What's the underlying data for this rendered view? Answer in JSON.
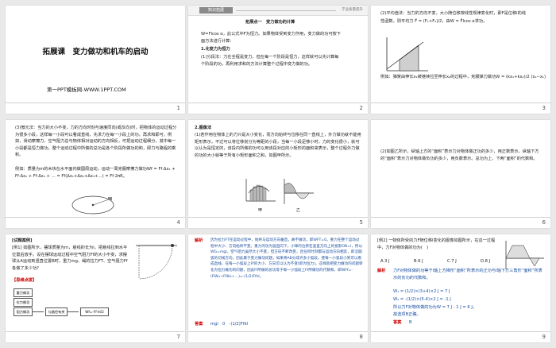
{
  "slide1": {
    "title": "拓展课　变力做功和机车的启动",
    "subtitle": "第一PPT模板网-WWW.1PPT.COM",
    "number": "1"
  },
  "slide2": {
    "tag": "知识拓展",
    "header_right": "学业质量提升",
    "heading": "拓展点一　变力做功的计算",
    "intro": "W=Flcos α，此公式中F为恒力。如果物体受到变力作用，变力做的功可按下",
    "intro2": "面方法进行计算：",
    "item1": "1.化变力为恒力",
    "item1_text": "(1)分段法：力在全程是变力，但在每一个阶段是恒力，这样就可以先计算每",
    "item1_text2": "个阶段的功，再利用求和的方法计算整个过程中变力做的功。",
    "number": "2"
  },
  "slide3": {
    "line1": "(2)平均值法：当力的方向不变，大小随位移按线性规律变化时，即F是位移l的线",
    "line2": "性函数，则平均力 F̄ = (F₁+F₂)/2，由W = F̄lcos α求功。",
    "line3": "例如：弹簧由伸长x₁被继续拉至伸长x₂的过程中，克服弹力做功W = (kx₁+kx₂)/2 (x₂−x₁)",
    "number": "3"
  },
  "slide4": {
    "para": "(3)微元法：当力的大小不变，力的方向时刻与速度同向(或反向)时，把物体的运动过程分为很多小段，这样每一小段可以看成直线，先求力在每一小段上的功，再求和即可。例如，滑动摩擦力、空气阻力总与物体相对运动的方向相反，可把运动过程细分，其中每一小段都是恒力做功，整个运动过程中所做的总功是各个阶段所做功的和，即力与路程的乘积。",
    "example": "例如：质量为m的木块在水平面内做圆周运动，运动一周克服摩擦力做功Wf = Ff·Δx₁ + Ff·Δx₂ + Ff·Δx₃ + … = Ff(Δx₁+Δx₂+Δx₃+…) = Ff·2πR。",
    "number": "4"
  },
  "slide5": {
    "heading": "2.图像法",
    "para": "(1)若作用在物体上的力只是大小变化，而方向始终与位移在同一直线上，外力做功就不能用矩形表示，不过可以将位移划分为等距的小段，当每一小段足够小时，力的变化很小，就可以认为是恒定的，该段内所做的功可以用该段对应的小矩形的面积来表示，整个过程外力做的功的大小就等于所有小矩形面积之和，如图甲所示。",
    "fig_a": "甲",
    "fig_b": "乙",
    "number": "5"
  },
  "slide6": {
    "para": "(2)如图乙所示，纵轴上方的“面积”表示力对物体做正功的多少，用正数表示，纵轴下方的“面积”表示力对物体做负功的多少，用负数表示。总功为上、下两“面积”的代数和。",
    "number": "6"
  },
  "slide7": {
    "tag": "[试题案例]",
    "example": "[例1] 如图所示，摆球质量为m，悬线的长为l，把悬线拉到水平位置后放手。设在摆球运动过程中空气阻力Ff的大小不变，求摆球从A运动到竖直位置B时，重力mg、绳的拉力FT、空气阻力Ff各做了多少功?",
    "think": "【思维点拨】",
    "flow": [
      "重力做功",
      "拉力做功",
      "阻力做功",
      "与路径有关",
      "Wf=-Ff·πl/2"
    ],
    "number": "7"
  },
  "slide8": {
    "label": "解析",
    "para": "因为拉力FT在运动过程中，始终与运动方向垂直，故不做功，即WFT=0。重力在整个运动过程中大小、方向始终不变，重力的功为竖直向下，小球的位移在竖直方向上的投影OB=l，所以WG=mgl。空气阻力虽然大小不变，但方向不断改变，且任何时刻都与运动方向相反，即沿圆弧的切线方向，因此属于变力做功问题，如果将AB分成许多小弧段，使每一小弧段小到可以看成直线，在每一小弧段上Ff的大小、方向可以认为不变(即为恒力)，这样就把变力做功的问题转化为恒力做功的问题，因此Ff所做的总功等于每一小弧段上Ff所做功的代数和，即WFf=-(FfΔl₁+FfΔl₂+…)=-(1/2)Ffπl。",
    "answer_label": "答案",
    "answer": "mgl　0　-(1/2)Ffπl",
    "number": "8"
  },
  "slide9": {
    "example": "[例2] 一物体所受的力F随位移l变化的图像如图所示，在这一过程中，力F对物体做的功为(　)",
    "options": [
      "A.3 J",
      "B.6 J",
      "C.7 J",
      "D.8 J"
    ],
    "label": "解析",
    "para": "力F对物体做的功等于l轴上方梯形“面积”所表示的正功与l轴下方三角形“面积”所表示的负功的代数和。",
    "eq1": "W₁ = (1/2)×(3+4)×2 J = 7 J",
    "eq2": "W₂ = -(1/2)×(5-4)×2 J = -1 J",
    "eq3": "所以力F对物体做的功为W = 7 J - 1 J = 6 J。",
    "result": "故选项B正确。",
    "answer_label": "答案",
    "answer": "B",
    "number": "9"
  },
  "colors": {
    "accent_blue": "#1a4fa0",
    "answer_red": "#c00000"
  }
}
